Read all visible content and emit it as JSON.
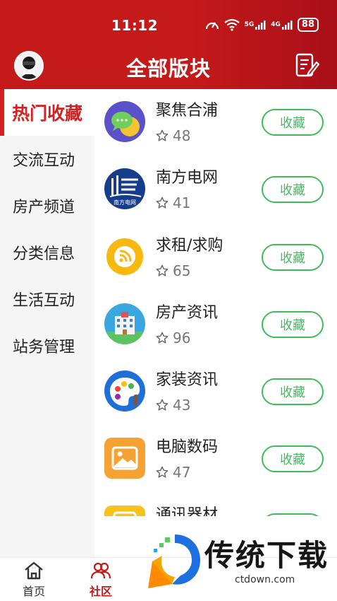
{
  "status": {
    "time": "11:12",
    "battery": "88",
    "net1": "5G",
    "net2": "4G"
  },
  "header": {
    "title": "全部版块"
  },
  "sidebar": {
    "items": [
      {
        "label": "热门收藏",
        "active": true
      },
      {
        "label": "交流互动",
        "active": false
      },
      {
        "label": "房产频道",
        "active": false
      },
      {
        "label": "分类信息",
        "active": false
      },
      {
        "label": "生活互动",
        "active": false
      },
      {
        "label": "站务管理",
        "active": false
      }
    ]
  },
  "forums": [
    {
      "name": "聚焦合浦",
      "count": "48",
      "button": "收藏",
      "icon": "chat-bubble-icon"
    },
    {
      "name": "南方电网",
      "count": "41",
      "button": "收藏",
      "icon": "southern-grid-logo-icon",
      "logo_text": "南方电网"
    },
    {
      "name": "求租/求购",
      "count": "65",
      "button": "收藏",
      "icon": "rss-icon"
    },
    {
      "name": "房产资讯",
      "count": "96",
      "button": "收藏",
      "icon": "building-icon"
    },
    {
      "name": "家装资讯",
      "count": "43",
      "button": "收藏",
      "icon": "paint-palette-icon"
    },
    {
      "name": "电脑数码",
      "count": "47",
      "button": "收藏",
      "icon": "image-icon"
    },
    {
      "name": "通讯器材",
      "count": "",
      "button": "收藏",
      "icon": "phone-icon"
    }
  ],
  "bottom_nav": [
    {
      "label": "首页",
      "icon": "home-icon",
      "active": false
    },
    {
      "label": "社区",
      "icon": "community-icon",
      "active": true
    }
  ],
  "watermark": {
    "text": "传统下载",
    "url": "ctdown.com"
  },
  "colors": {
    "header_red": "#c51a1a",
    "active_red": "#d42020",
    "button_green": "#3dbd5c"
  }
}
